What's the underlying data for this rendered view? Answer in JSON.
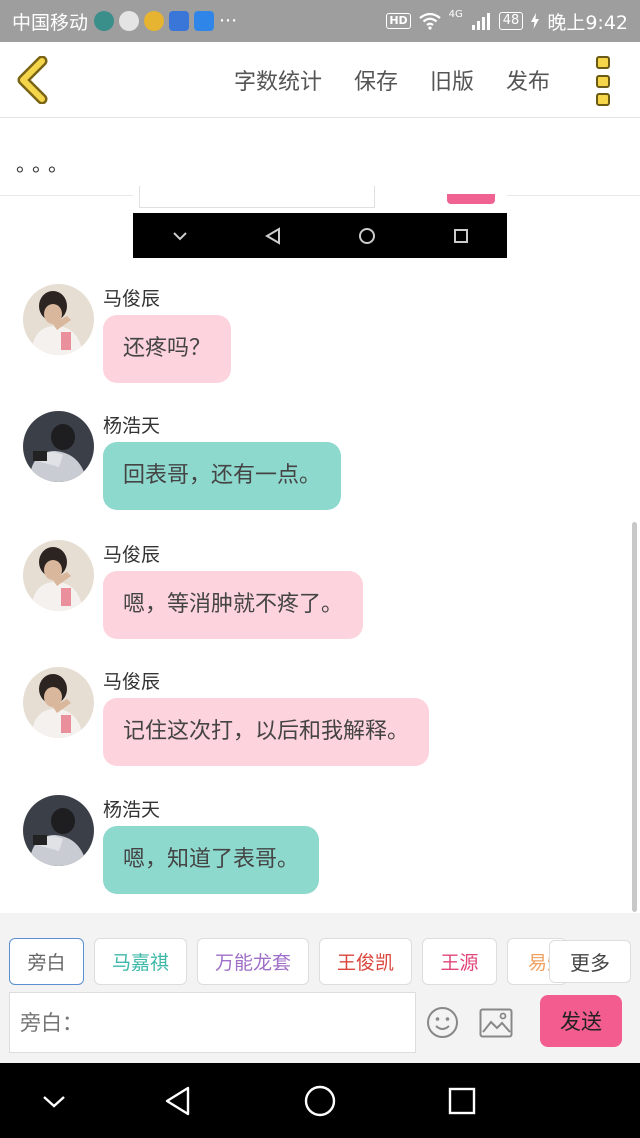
{
  "status_bar": {
    "carrier": "中国移动",
    "overflow": "···",
    "hd": "HD",
    "network": "4G",
    "battery": "48",
    "time": "晚上9:42"
  },
  "header": {
    "actions": [
      "字数统计",
      "保存",
      "旧版",
      "发布"
    ]
  },
  "notice": {
    "text": "。。。"
  },
  "messages": [
    {
      "name": "马俊辰",
      "text": "还疼吗？",
      "color": "pink"
    },
    {
      "name": "杨浩天",
      "text": "回表哥，还有一点。",
      "color": "teal"
    },
    {
      "name": "马俊辰",
      "text": "嗯，等消肿就不疼了。",
      "color": "pink"
    },
    {
      "name": "马俊辰",
      "text": "记住这次打，以后和我解释。",
      "color": "pink"
    },
    {
      "name": "杨浩天",
      "text": "嗯，知道了表哥。",
      "color": "teal"
    }
  ],
  "toolbar": {
    "roles": [
      "旁白",
      "马嘉祺",
      "万能龙套",
      "王俊凯",
      "王源",
      "易烊"
    ],
    "role_colors": [
      "#666666",
      "#3db8a8",
      "#a070c8",
      "#d9453b",
      "#e0457b",
      "#f0a060"
    ],
    "more_label": "更多",
    "input_placeholder": "旁白：",
    "send_label": "发送"
  },
  "colors": {
    "pink_bubble": "#fdd3dd",
    "teal_bubble": "#8ed9ce",
    "send_button": "#f25c8f",
    "accent_yellow": "#f5d64a"
  }
}
